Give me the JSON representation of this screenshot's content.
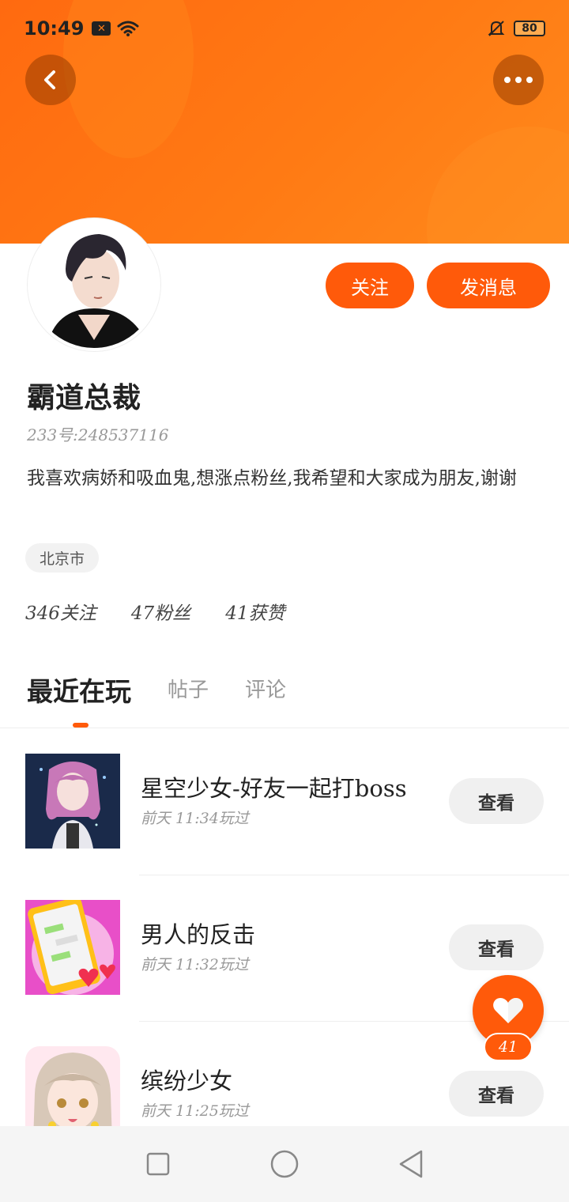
{
  "status_bar": {
    "time": "10:49",
    "battery": "80",
    "icons": [
      "notification-x-icon",
      "wifi-icon",
      "bell-muted-icon",
      "battery-icon"
    ]
  },
  "header": {
    "back_icon": "chevron-left-icon",
    "more_icon": "more-horizontal-icon",
    "accent_color": "#ff6a10"
  },
  "profile": {
    "follow_label": "关注",
    "message_label": "发消息",
    "name": "霸道总裁",
    "id_text": "233号:248537116",
    "bio": "我喜欢病娇和吸血鬼,想涨点粉丝,我希望和大家成为朋友,谢谢",
    "location": "北京市",
    "stats": {
      "following": "346关注",
      "followers": "47粉丝",
      "likes": "41获赞"
    }
  },
  "tabs": [
    {
      "label": "最近在玩"
    },
    {
      "label": "帖子"
    },
    {
      "label": "评论"
    }
  ],
  "games": [
    {
      "title": "星空少女-好友一起打boss",
      "time": "前天 11:34玩过",
      "button": "查看"
    },
    {
      "title": "男人的反击",
      "time": "前天 11:32玩过",
      "button": "查看"
    },
    {
      "title": "缤纷少女",
      "time": "前天 11:25玩过",
      "button": "查看"
    }
  ],
  "like_fab": {
    "count": "41",
    "icon": "heart-icon",
    "color": "#ff5a0a"
  },
  "nav_bar": {
    "icons": [
      "recent-apps-icon",
      "home-icon",
      "back-triangle-icon"
    ]
  }
}
